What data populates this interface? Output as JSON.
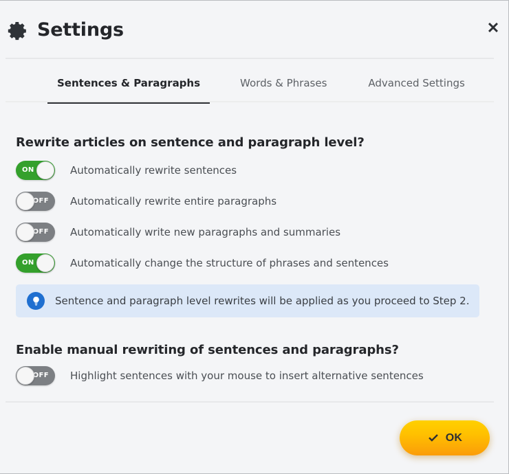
{
  "dialog": {
    "title": "Settings",
    "gear_icon": "gear-icon",
    "close_icon": "✕"
  },
  "tabs": [
    {
      "label": "Sentences & Paragraphs",
      "active": true
    },
    {
      "label": "Words & Phrases",
      "active": false
    },
    {
      "label": "Advanced Settings",
      "active": false
    }
  ],
  "sections": [
    {
      "title": "Rewrite articles on sentence and paragraph level?",
      "rows": [
        {
          "state": "ON",
          "label": "Automatically rewrite sentences"
        },
        {
          "state": "OFF",
          "label": "Automatically rewrite entire paragraphs"
        },
        {
          "state": "OFF",
          "label": "Automatically write new paragraphs and summaries"
        },
        {
          "state": "ON",
          "label": "Automatically change the structure of phrases and sentences"
        }
      ]
    },
    {
      "title": "Enable manual rewriting of sentences and paragraphs?",
      "rows": [
        {
          "state": "OFF",
          "label": "Highlight sentences with your mouse to insert alternative sentences"
        }
      ]
    }
  ],
  "notice": {
    "icon": "lightbulb-icon",
    "text": "Sentence and paragraph level rewrites will be applied as you proceed to Step 2."
  },
  "footer": {
    "ok_label": "OK",
    "ok_icon": "check-icon"
  },
  "colors": {
    "toggle_on": "#34a02c",
    "toggle_off": "#7c7f83",
    "notice_bg": "#dce8f8",
    "notice_icon_bg": "#1f6fd0",
    "ok_button_top": "#ffd000",
    "ok_button_bottom": "#fb9c09",
    "active_tab_underline": "#2c2f33",
    "dialog_bg": "#f4f5f7"
  }
}
